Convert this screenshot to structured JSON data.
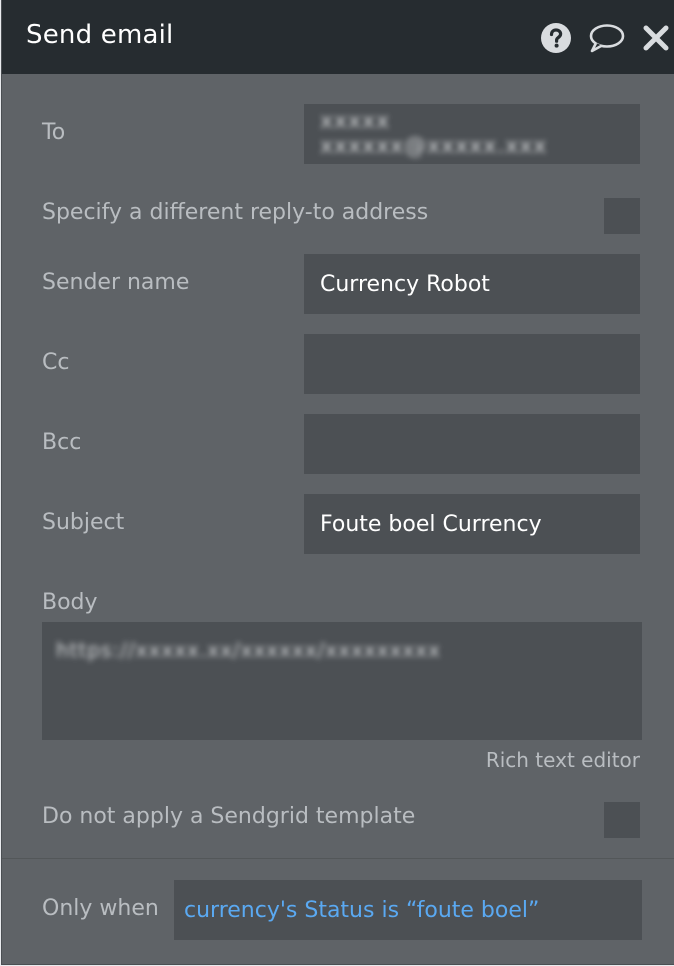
{
  "header": {
    "title": "Send email",
    "icons": [
      "help-icon",
      "comment-icon",
      "close-icon"
    ]
  },
  "form": {
    "to": {
      "label": "To",
      "value": "xxxxx xxxxxx@xxxxx.xxx"
    },
    "reply_to": {
      "label": "Specify a different reply-to address",
      "checked": false
    },
    "sender_name": {
      "label": "Sender name",
      "value": "Currency Robot"
    },
    "cc": {
      "label": "Cc",
      "value": ""
    },
    "bcc": {
      "label": "Bcc",
      "value": ""
    },
    "subject": {
      "label": "Subject",
      "value": "Foute boel Currency"
    },
    "body": {
      "label": "Body",
      "value": "https://xxxxx.xx/xxxxxx/xxxxxxxxx",
      "rich_text_label": "Rich text editor"
    },
    "sendgrid": {
      "label": "Do not apply a Sendgrid template",
      "checked": false
    }
  },
  "condition": {
    "label": "Only when",
    "expression": "currency's Status is “foute boel”"
  },
  "colors": {
    "header_bg": "#262c30",
    "panel_bg": "#5f6367",
    "field_bg": "#4c5054",
    "label_text": "#b9bdc1",
    "expression_blue": "#5aa9f2"
  }
}
